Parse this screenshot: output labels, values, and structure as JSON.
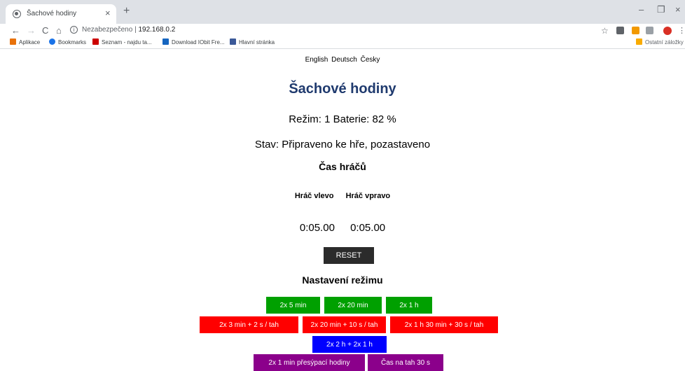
{
  "browser": {
    "tab_title": "Šachové hodiny",
    "tab_close": "×",
    "new_tab": "+",
    "window_controls": {
      "minimize": "–",
      "maximize": "❐",
      "close": "×"
    },
    "nav": {
      "back": "←",
      "forward": "→",
      "reload": "C",
      "home": "⌂"
    },
    "url_prefix": "Nezabezpečeno",
    "url_separator": "|",
    "url": "192.168.0.2",
    "bookmarks": [
      {
        "label": "Aplikace",
        "icon": "apps-grid-icon",
        "color": "#e8710a"
      },
      {
        "label": "Bookmarks",
        "icon": "star-icon",
        "color": "#1a73e8"
      },
      {
        "label": "Seznam - najdu ta...",
        "icon": "seznam-icon",
        "color": "#cc0000"
      },
      {
        "label": "Download IObit Fre...",
        "icon": "iobit-icon",
        "color": "#1565c0"
      },
      {
        "label": "Hlavní stránka",
        "icon": "facebook-icon",
        "color": "#3b5998"
      }
    ],
    "other_bookmarks": "Ostatní záložky"
  },
  "page": {
    "languages": [
      "English",
      "Deutsch",
      "Česky"
    ],
    "title": "Šachové hodiny",
    "mode_line": "Režim: 1 Baterie: 82 %",
    "state_line": "Stav: Připraveno ke hře, pozastaveno",
    "players_heading": "Čas hráčů",
    "player_left_label": "Hráč vlevo",
    "player_right_label": "Hráč vpravo",
    "player_left_time": "0:05.00",
    "player_right_time": "0:05.00",
    "reset_label": "RESET",
    "mode_heading": "Nastavení režimu",
    "mode_buttons": [
      "2x 5 min",
      "2x 20 min",
      "2x 1 h",
      "2x 3 min + 2 s / tah",
      "2x 20 min + 10 s / tah",
      "2x 1 h 30 min + 30 s / tah",
      "2x 2 h + 2x 1 h",
      "2x 1 min přesýpací hodiny",
      "Čas na tah 30 s"
    ],
    "colors": {
      "title": "#1f3a6e",
      "green": "#00a000",
      "red": "#ff0000",
      "blue": "#0000ff",
      "purple": "#8b008b",
      "reset": "#2b2b2b"
    }
  }
}
